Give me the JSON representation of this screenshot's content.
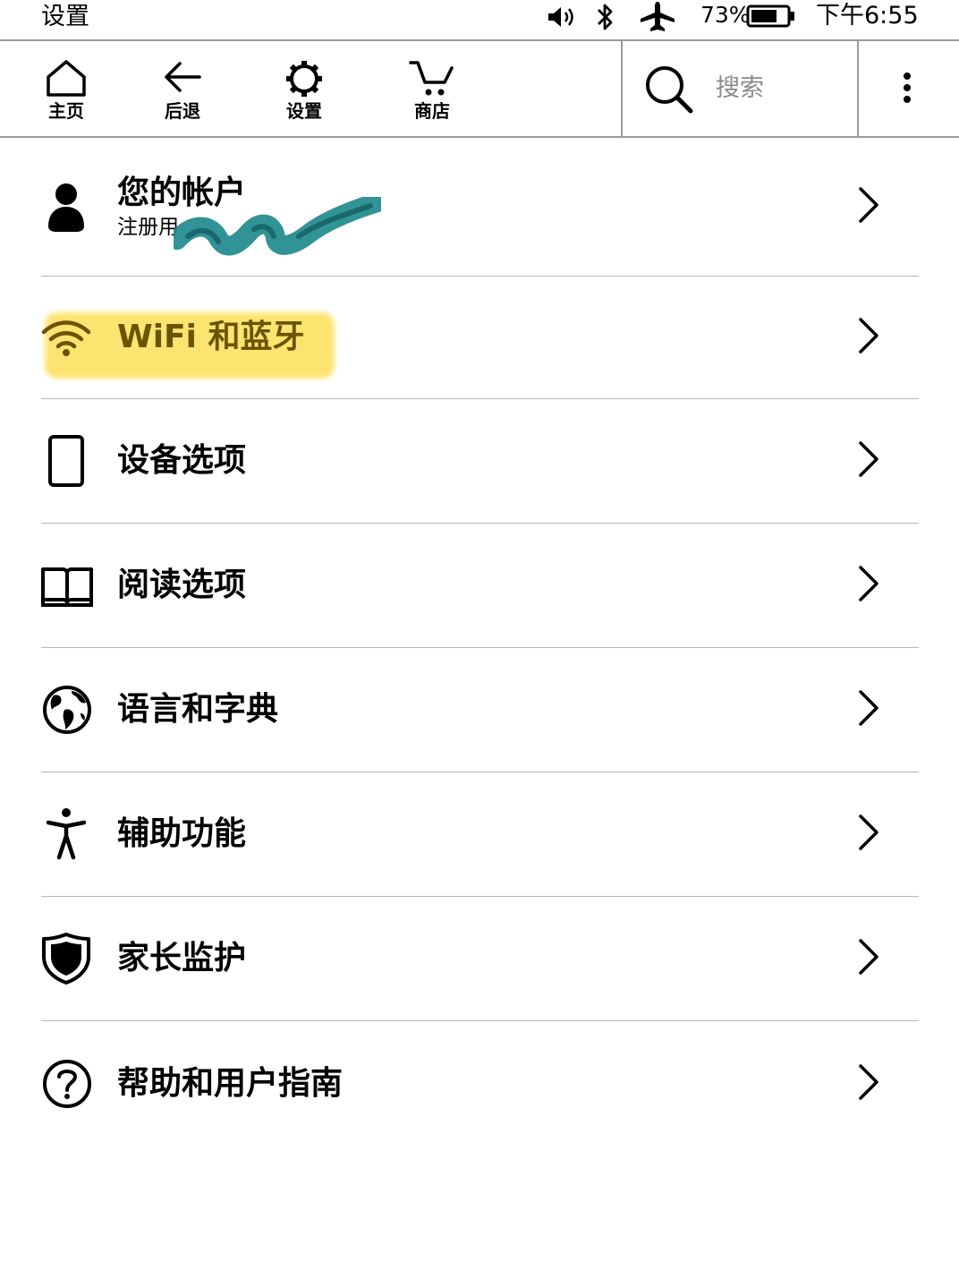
{
  "status_bar": {
    "title": "设置",
    "battery_percent": "73%",
    "battery_level": 0.73,
    "time": "下午6:55"
  },
  "toolbar": {
    "home_label": "主页",
    "back_label": "后退",
    "settings_label": "设置",
    "store_label": "商店",
    "search_placeholder": "搜索"
  },
  "settings": {
    "account": {
      "label": "您的帐户",
      "sub_label": "注册用"
    },
    "items": [
      {
        "label": "WiFi 和蓝牙",
        "icon": "wifi-icon"
      },
      {
        "label": "设备选项",
        "icon": "device-icon"
      },
      {
        "label": "阅读选项",
        "icon": "book-icon"
      },
      {
        "label": "语言和字典",
        "icon": "globe-icon"
      },
      {
        "label": "辅助功能",
        "icon": "accessibility-icon"
      },
      {
        "label": "家长监护",
        "icon": "shield-icon"
      },
      {
        "label": "帮助和用户指南",
        "icon": "help-icon"
      }
    ]
  },
  "colors": {
    "highlight": "#fde36a",
    "scribble": "#1f8a8c",
    "divider": "#b8b8b8"
  }
}
